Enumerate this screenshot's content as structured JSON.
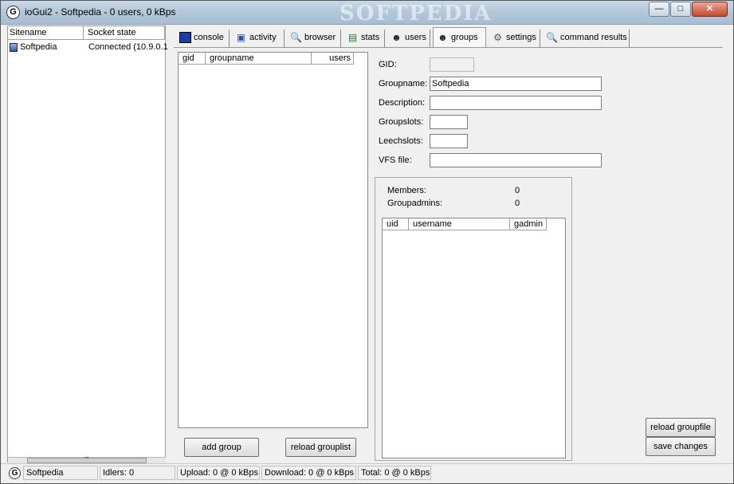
{
  "window": {
    "title": "ioGui2 - Softpedia - 0 users, 0 kBps",
    "watermark": "SOFTPEDIA",
    "minimize": "—",
    "maximize": "□",
    "close": "✕"
  },
  "sites": {
    "headers": [
      "Sitename",
      "Socket state"
    ],
    "rows": [
      {
        "name": "Softpedia",
        "state": "Connected (10.9.0.1"
      }
    ],
    "scroll_grip": "'''"
  },
  "tabs": [
    {
      "label": "console",
      "icon": "console-icon"
    },
    {
      "label": "activity",
      "icon": "activity-icon"
    },
    {
      "label": "browser",
      "icon": "browser-icon"
    },
    {
      "label": "stats",
      "icon": "stats-icon"
    },
    {
      "label": "users",
      "icon": "users-icon"
    },
    {
      "label": "groups",
      "icon": "groups-icon",
      "active": true
    },
    {
      "label": "settings",
      "icon": "settings-icon"
    },
    {
      "label": "command results",
      "icon": "command-results-icon"
    }
  ],
  "groups_list": {
    "headers": [
      "gid",
      "groupname",
      "users"
    ]
  },
  "form": {
    "gid_label": "GID:",
    "gid_value": "",
    "groupname_label": "Groupname:",
    "groupname_value": "Softpedia",
    "description_label": "Description:",
    "description_placeholder": "",
    "groupslots_label": "Groupslots:",
    "groupslots_value": "",
    "leechslots_label": "Leechslots:",
    "leechslots_value": "",
    "vfs_label": "VFS file:",
    "vfs_value": ""
  },
  "members": {
    "members_label": "Members:",
    "members_value": "0",
    "groupadmins_label": "Groupadmins:",
    "groupadmins_value": "0",
    "headers": [
      "uid",
      "username",
      "gadmin"
    ]
  },
  "buttons": {
    "add_group": "add group",
    "reload_grouplist": "reload grouplist",
    "reload_groupfile": "reload groupfile",
    "save_changes": "save changes"
  },
  "status": {
    "site": "Softpedia",
    "idlers": "Idlers: 0",
    "upload": "Upload: 0 @ 0 kBps",
    "download": "Download: 0 @ 0 kBps",
    "total": "Total: 0 @ 0 kBps"
  }
}
